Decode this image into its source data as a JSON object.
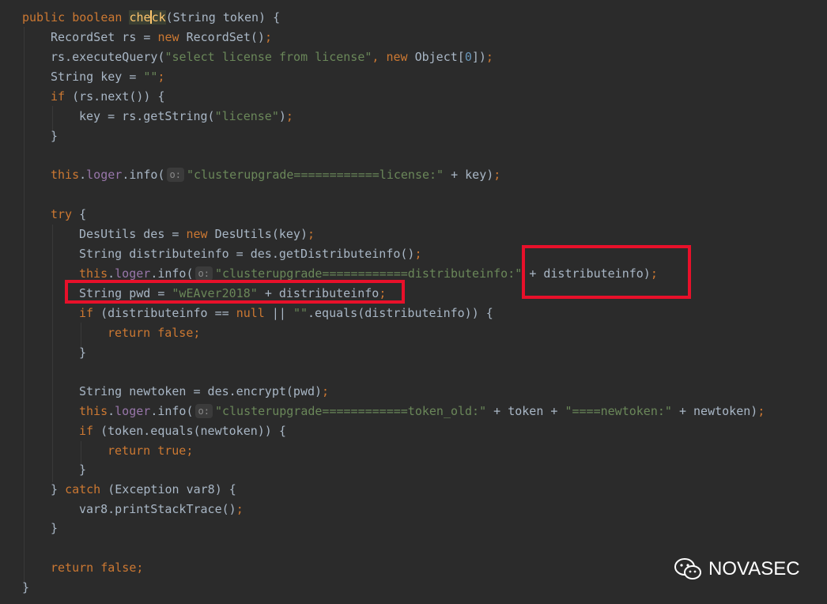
{
  "watermark": {
    "text": "NOVASEC",
    "icon": "wechat-icon"
  },
  "inlay_hint": "o:",
  "code_lines": [
    "public boolean check(String token) {",
    "RecordSet rs = new RecordSet();",
    "rs.executeQuery(\"select license from license\", new Object[0]);",
    "String key = \"\";",
    "if (rs.next()) {",
    "key = rs.getString(\"license\");",
    "}",
    "",
    "this.loger.info(\"clusterupgrade============license:\" + key);",
    "",
    "try {",
    "DesUtils des = new DesUtils(key);",
    "String distributeinfo = des.getDistributeinfo();",
    "this.loger.info(\"clusterupgrade============distributeinfo:\" + distributeinfo);",
    "String pwd = \"wEAver2018\" + distributeinfo;",
    "if (distributeinfo == null || \"\".equals(distributeinfo)) {",
    "return false;",
    "}",
    "",
    "String newtoken = des.encrypt(pwd);",
    "this.loger.info(\"clusterupgrade============token_old:\" + token + \"====newtoken:\" + newtoken);",
    "if (token.equals(newtoken)) {",
    "return true;",
    "}",
    "} catch (Exception var8) {",
    "var8.printStackTrace();",
    "}",
    "",
    "return false;",
    "}"
  ],
  "colors": {
    "background": "#2b2b2b",
    "keyword": "#cc7832",
    "string": "#6a8759",
    "number": "#6897bb",
    "field": "#9876aa",
    "method_decl": "#ffc66d",
    "text": "#a9b7c6",
    "highlight_box": "#e8102a"
  }
}
